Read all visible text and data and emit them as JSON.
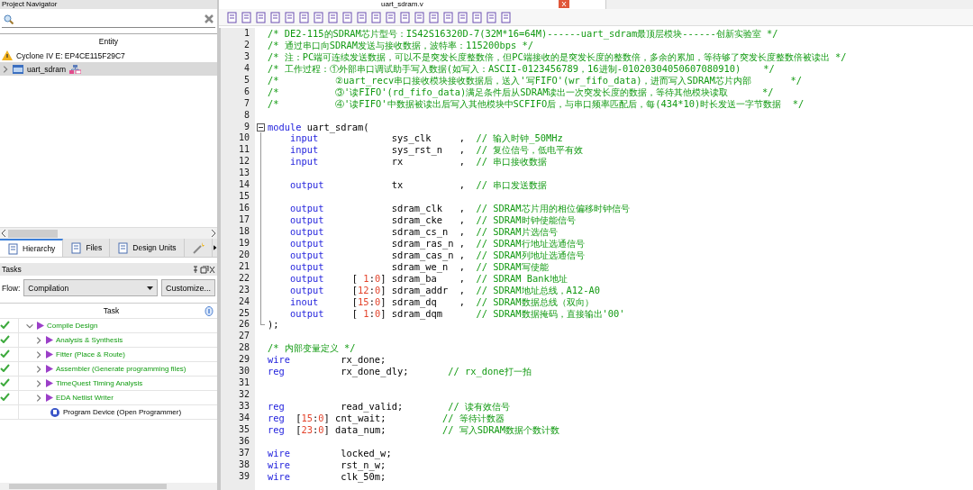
{
  "navigator": {
    "title": "Project Navigator",
    "column": "Entity",
    "tree": [
      {
        "label": "Cyclone IV E: EP4CE115F29C7",
        "kind": "device",
        "selected": false
      },
      {
        "label": "uart_sdram",
        "kind": "entity",
        "selected": true,
        "expanded": false
      }
    ],
    "tabs": [
      {
        "label": "Hierarchy",
        "selected": true
      },
      {
        "label": "Files",
        "selected": false
      },
      {
        "label": "Design Units",
        "selected": false
      }
    ]
  },
  "tasks": {
    "title": "Tasks",
    "flow_label": "Flow:",
    "flow_value": "Compilation",
    "customize": "Customize...",
    "column": "Task",
    "items": [
      {
        "label": "Compile Design",
        "kind": "compile",
        "done": true,
        "expanded": true,
        "children": [
          {
            "label": "Analysis & Synthesis",
            "kind": "compile",
            "done": true,
            "expanded": false
          },
          {
            "label": "Fitter (Place & Route)",
            "kind": "compile",
            "done": true,
            "expanded": false
          },
          {
            "label": "Assembler (Generate programming files)",
            "kind": "compile",
            "done": true,
            "expanded": false
          },
          {
            "label": "TimeQuest Timing Analysis",
            "kind": "compile",
            "done": true,
            "expanded": false
          },
          {
            "label": "EDA Netlist Writer",
            "kind": "compile",
            "done": true,
            "expanded": false
          }
        ]
      },
      {
        "label": "Program Device (Open Programmer)",
        "kind": "program",
        "done": false
      }
    ]
  },
  "editor": {
    "tab": "uart_sdram.v",
    "lines": [
      {
        "number": "1",
        "tokens": [
          {
            "kind": "cm",
            "text": "/* DE2-115的SDRAM芯片型号：IS42S16320D-7(32M*16=64M)------uart_sdram最顶层模块------创新实验室 */"
          }
        ]
      },
      {
        "number": "2",
        "tokens": [
          {
            "kind": "cm",
            "text": "/* 通过串口向SDRAM发送与接收数据，波特率：115200bps */"
          }
        ]
      },
      {
        "number": "3",
        "tokens": [
          {
            "kind": "cm",
            "text": "/* 注：PC端可连续发送数据，可以不是突发长度整数倍，但PC端接收的是突发长度的整数倍，多余的累加，等待够了突发长度整数倍被读出 */"
          }
        ]
      },
      {
        "number": "4",
        "tokens": [
          {
            "kind": "cm",
            "text": "/* 工作过程：①外部串口调试助手写入数据(如写入：ASCII-0123456789，16进制-01020304050607080910)    */"
          }
        ]
      },
      {
        "number": "5",
        "tokens": [
          {
            "kind": "cm",
            "text": "/*          ②uart_recv串口接收模块接收数据后，送入'写FIFO'(wr_fifo_data)，进而写入SDRAM芯片内部       */"
          }
        ]
      },
      {
        "number": "6",
        "tokens": [
          {
            "kind": "cm",
            "text": "/*          ③'读FIFO'(rd_fifo_data)满足条件后从SDRAM读出一次突发长度的数据，等待其他模块读取      */"
          }
        ]
      },
      {
        "number": "7",
        "tokens": [
          {
            "kind": "cm",
            "text": "/*          ④'读FIFO'中数据被读出后写入其他模块中SCFIFO后，与串口频率匹配后，每(434*10)时长发送一字节数据  */"
          }
        ]
      },
      {
        "number": "8"
      },
      {
        "number": "9",
        "expanded": true,
        "tokens": [
          {
            "kind": "kw",
            "text": "module"
          },
          {
            "kind": "id",
            "text": " uart_sdram("
          }
        ],
        "children": [
          {
            "number": "10",
            "tokens": [
              {
                "kind": "kw",
                "text": "    input"
              },
              {
                "kind": "id",
                "text": "             sys_clk     ,  "
              },
              {
                "kind": "cm",
                "text": "// 输入时钟_50MHz"
              }
            ]
          },
          {
            "number": "11",
            "tokens": [
              {
                "kind": "kw",
                "text": "    input"
              },
              {
                "kind": "id",
                "text": "             sys_rst_n   ,  "
              },
              {
                "kind": "cm",
                "text": "// 复位信号，低电平有效"
              }
            ]
          },
          {
            "number": "12",
            "tokens": [
              {
                "kind": "kw",
                "text": "    input"
              },
              {
                "kind": "id",
                "text": "             rx          ,  "
              },
              {
                "kind": "cm",
                "text": "// 串口接收数据"
              }
            ]
          },
          {
            "number": "13"
          },
          {
            "number": "14",
            "tokens": [
              {
                "kind": "kw",
                "text": "    output"
              },
              {
                "kind": "id",
                "text": "            tx          ,  "
              },
              {
                "kind": "cm",
                "text": "// 串口发送数据"
              }
            ]
          },
          {
            "number": "15"
          },
          {
            "number": "16",
            "tokens": [
              {
                "kind": "kw",
                "text": "    output"
              },
              {
                "kind": "id",
                "text": "            sdram_clk   ,  "
              },
              {
                "kind": "cm",
                "text": "// SDRAM芯片用的相位偏移时钟信号"
              }
            ]
          },
          {
            "number": "17",
            "tokens": [
              {
                "kind": "kw",
                "text": "    output"
              },
              {
                "kind": "id",
                "text": "            sdram_cke   ,  "
              },
              {
                "kind": "cm",
                "text": "// SDRAM时钟使能信号"
              }
            ]
          },
          {
            "number": "18",
            "tokens": [
              {
                "kind": "kw",
                "text": "    output"
              },
              {
                "kind": "id",
                "text": "            sdram_cs_n  ,  "
              },
              {
                "kind": "cm",
                "text": "// SDRAM片选信号"
              }
            ]
          },
          {
            "number": "19",
            "tokens": [
              {
                "kind": "kw",
                "text": "    output"
              },
              {
                "kind": "id",
                "text": "            sdram_ras_n ,  "
              },
              {
                "kind": "cm",
                "text": "// SDRAM行地址选通信号"
              }
            ]
          },
          {
            "number": "20",
            "tokens": [
              {
                "kind": "kw",
                "text": "    output"
              },
              {
                "kind": "id",
                "text": "            sdram_cas_n ,  "
              },
              {
                "kind": "cm",
                "text": "// SDRAM列地址选通信号"
              }
            ]
          },
          {
            "number": "21",
            "tokens": [
              {
                "kind": "kw",
                "text": "    output"
              },
              {
                "kind": "id",
                "text": "            sdram_we_n  ,  "
              },
              {
                "kind": "cm",
                "text": "// SDRAM写使能"
              }
            ]
          },
          {
            "number": "22",
            "tokens": [
              {
                "kind": "kw",
                "text": "    output"
              },
              {
                "kind": "id",
                "text": "     [ "
              },
              {
                "kind": "num",
                "text": "1"
              },
              {
                "kind": "id",
                "text": ":"
              },
              {
                "kind": "num",
                "text": "0"
              },
              {
                "kind": "id",
                "text": "] sdram_ba    ,  "
              },
              {
                "kind": "cm",
                "text": "// SDRAM Bank地址"
              }
            ]
          },
          {
            "number": "23",
            "tokens": [
              {
                "kind": "kw",
                "text": "    output"
              },
              {
                "kind": "id",
                "text": "     ["
              },
              {
                "kind": "num",
                "text": "12"
              },
              {
                "kind": "id",
                "text": ":"
              },
              {
                "kind": "num",
                "text": "0"
              },
              {
                "kind": "id",
                "text": "] sdram_addr  ,  "
              },
              {
                "kind": "cm",
                "text": "// SDRAM地址总线，A12-A0"
              }
            ]
          },
          {
            "number": "24",
            "tokens": [
              {
                "kind": "kw",
                "text": "    inout"
              },
              {
                "kind": "id",
                "text": "      ["
              },
              {
                "kind": "num",
                "text": "15"
              },
              {
                "kind": "id",
                "text": ":"
              },
              {
                "kind": "num",
                "text": "0"
              },
              {
                "kind": "id",
                "text": "] sdram_dq    ,  "
              },
              {
                "kind": "cm",
                "text": "// SDRAM数据总线（双向）"
              }
            ]
          },
          {
            "number": "25",
            "tokens": [
              {
                "kind": "kw",
                "text": "    output"
              },
              {
                "kind": "id",
                "text": "     [ "
              },
              {
                "kind": "num",
                "text": "1"
              },
              {
                "kind": "id",
                "text": ":"
              },
              {
                "kind": "num",
                "text": "0"
              },
              {
                "kind": "id",
                "text": "] sdram_dqm      "
              },
              {
                "kind": "cm",
                "text": "// SDRAM数据掩码，直接输出'00'"
              }
            ]
          },
          {
            "number": "26",
            "tokens": [
              {
                "kind": "id",
                "text": ");"
              }
            ]
          }
        ]
      },
      {
        "number": "27"
      },
      {
        "number": "28",
        "tokens": [
          {
            "kind": "cm",
            "text": "/* 内部变量定义 */"
          }
        ]
      },
      {
        "number": "29",
        "tokens": [
          {
            "kind": "kw",
            "text": "wire"
          },
          {
            "kind": "id",
            "text": "         rx_done;"
          }
        ]
      },
      {
        "number": "30",
        "tokens": [
          {
            "kind": "kw",
            "text": "reg"
          },
          {
            "kind": "id",
            "text": "          rx_done_dly;       "
          },
          {
            "kind": "cm",
            "text": "// rx_done打一拍"
          }
        ]
      },
      {
        "number": "31"
      },
      {
        "number": "32"
      },
      {
        "number": "33",
        "tokens": [
          {
            "kind": "kw",
            "text": "reg"
          },
          {
            "kind": "id",
            "text": "          read_valid;        "
          },
          {
            "kind": "cm",
            "text": "// 读有效信号"
          }
        ]
      },
      {
        "number": "34",
        "tokens": [
          {
            "kind": "kw",
            "text": "reg"
          },
          {
            "kind": "id",
            "text": "  ["
          },
          {
            "kind": "num",
            "text": "15"
          },
          {
            "kind": "id",
            "text": ":"
          },
          {
            "kind": "num",
            "text": "0"
          },
          {
            "kind": "id",
            "text": "] cnt_wait;          "
          },
          {
            "kind": "cm",
            "text": "// 等待计数器"
          }
        ]
      },
      {
        "number": "35",
        "tokens": [
          {
            "kind": "kw",
            "text": "reg"
          },
          {
            "kind": "id",
            "text": "  ["
          },
          {
            "kind": "num",
            "text": "23"
          },
          {
            "kind": "id",
            "text": ":"
          },
          {
            "kind": "num",
            "text": "0"
          },
          {
            "kind": "id",
            "text": "] data_num;          "
          },
          {
            "kind": "cm",
            "text": "// 写入SDRAM数据个数计数"
          }
        ]
      },
      {
        "number": "36"
      },
      {
        "number": "37",
        "tokens": [
          {
            "kind": "kw",
            "text": "wire"
          },
          {
            "kind": "id",
            "text": "         locked_w;"
          }
        ]
      },
      {
        "number": "38",
        "tokens": [
          {
            "kind": "kw",
            "text": "wire"
          },
          {
            "kind": "id",
            "text": "         rst_n_w;"
          }
        ]
      },
      {
        "number": "39",
        "tokens": [
          {
            "kind": "kw",
            "text": "wire"
          },
          {
            "kind": "id",
            "text": "         clk_50m;"
          }
        ]
      }
    ]
  }
}
